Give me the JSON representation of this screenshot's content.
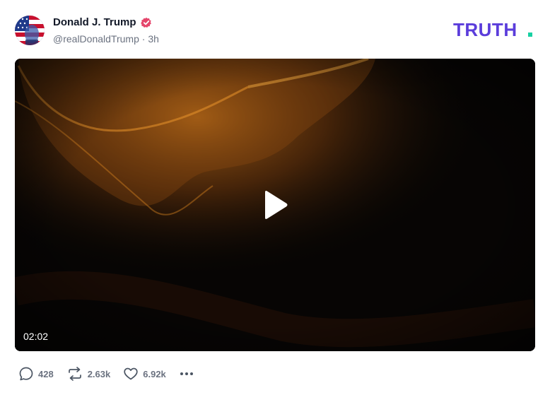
{
  "author": {
    "display_name": "Donald J. Trump",
    "handle": "@realDonaldTrump",
    "separator": "·",
    "time": "3h",
    "verified_icon": "verified-badge-icon",
    "badge_color": "#e5466c"
  },
  "brand": {
    "logo_text": "TRUTH",
    "logo_color": "#5b3ddb",
    "dot_color": "#18d1a3"
  },
  "video": {
    "duration": "02:02",
    "play_icon": "play-icon"
  },
  "actions": {
    "replies": "428",
    "retruths": "2.63k",
    "likes": "6.92k",
    "reply_icon": "reply-icon",
    "retruth_icon": "retruth-icon",
    "like_icon": "heart-icon",
    "more_icon": "more-dots-icon"
  }
}
